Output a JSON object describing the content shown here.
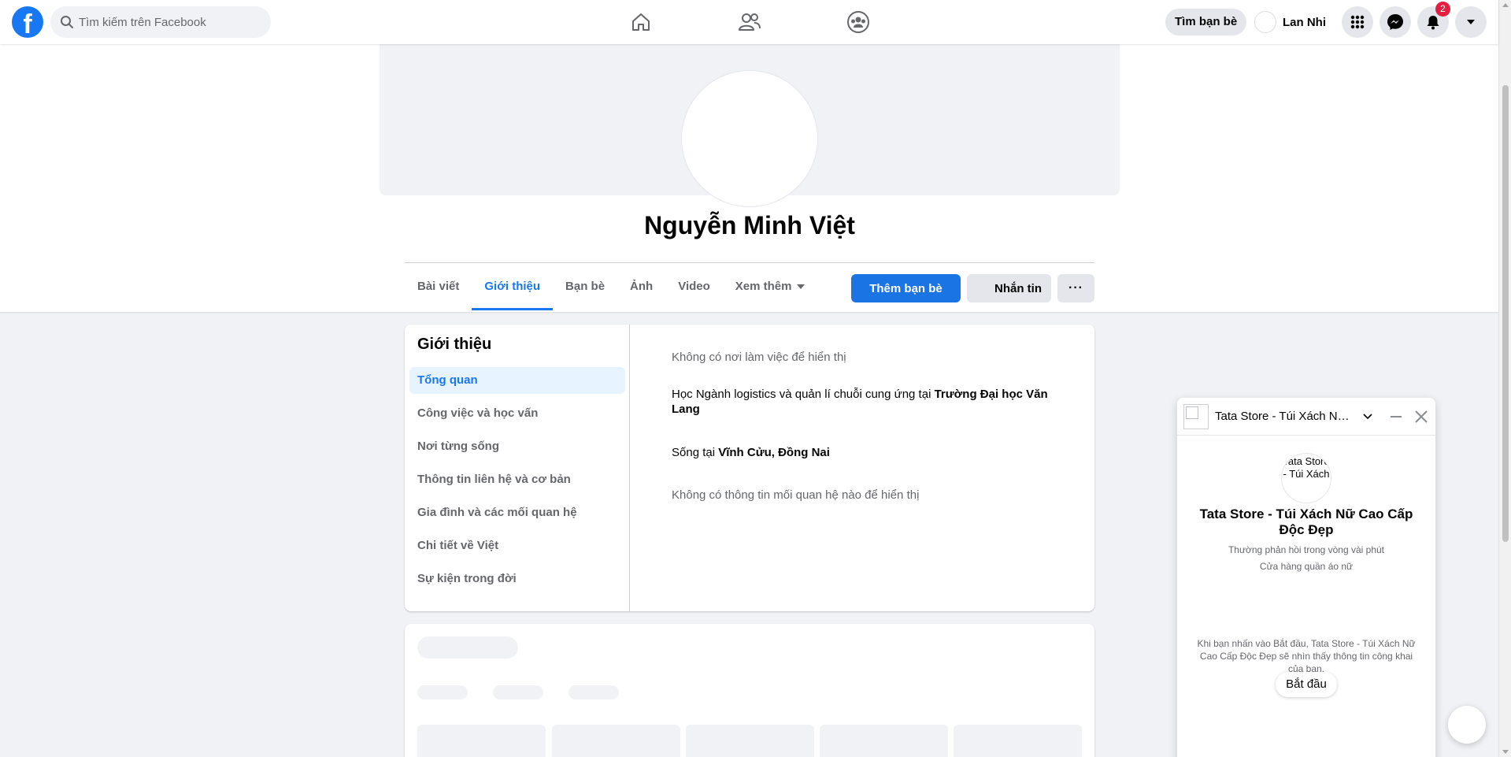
{
  "topbar": {
    "logo_letter": "f",
    "search_placeholder": "Tìm kiếm trên Facebook",
    "nav_icons": [
      "home-icon",
      "friends-icon",
      "groups-icon"
    ],
    "find_friends_label": "Tìm bạn bè",
    "user_name": "Lan Nhi",
    "notification_count": "2"
  },
  "profile": {
    "name": "Nguyễn Minh Việt",
    "tabs": [
      {
        "label": "Bài viết"
      },
      {
        "label": "Giới thiệu"
      },
      {
        "label": "Bạn bè"
      },
      {
        "label": "Ảnh"
      },
      {
        "label": "Video"
      },
      {
        "label": "Xem thêm"
      }
    ],
    "add_friend_label": "Thêm bạn bè",
    "message_label": "Nhắn tin",
    "more_label": "···"
  },
  "about": {
    "title": "Giới thiệu",
    "menu": [
      {
        "label": "Tổng quan"
      },
      {
        "label": "Công việc và học vấn"
      },
      {
        "label": "Nơi từng sống"
      },
      {
        "label": "Thông tin liên hệ và cơ bản"
      },
      {
        "label": "Gia đình và các mối quan hệ"
      },
      {
        "label": "Chi tiết về Việt"
      },
      {
        "label": "Sự kiện trong đời"
      }
    ],
    "work_empty": "Không có nơi làm việc để hiển thị",
    "education_prefix": "Học Ngành logistics và quản lí chuỗi cung ứng tại ",
    "education_school": "Trường Đại học Văn Lang",
    "lives_prefix": "Sống tại ",
    "lives_place": "Vĩnh Cửu, Đồng Nai",
    "relationship_empty": "Không có thông tin mối quan hệ nào để hiển thị"
  },
  "chat": {
    "header_title": "Tata Store - Túi Xách Nữ Cao Cấp Độc Đẹp",
    "avatar_alt": "Tata Store - Túi Xách",
    "page_name": "Tata Store - Túi Xách Nữ Cao Cấp Độc Đẹp",
    "response_time": "Thường phản hồi trong vòng vài phút",
    "category": "Cửa hàng quần áo nữ",
    "privacy_note": "Khi bạn nhấn vào Bắt đầu, Tata Store - Túi Xách Nữ Cao Cấp Độc Đẹp sẽ nhìn thấy thông tin công khai của bạn.",
    "start_label": "Bắt đầu"
  },
  "colors": {
    "accent": "#1877f2",
    "badge": "#e41e3f",
    "background": "#f0f2f5"
  }
}
